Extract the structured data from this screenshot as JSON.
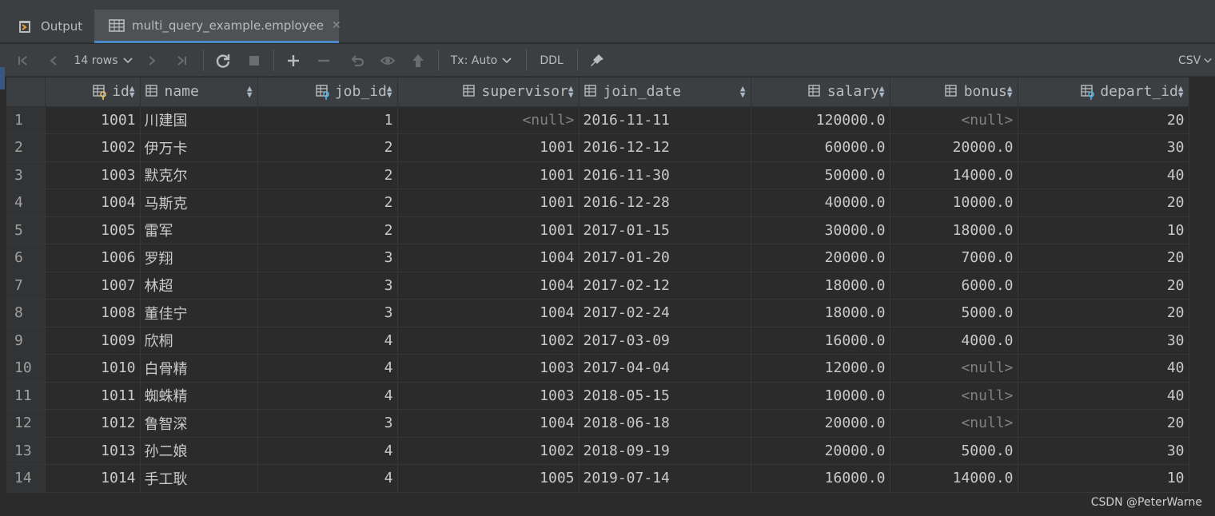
{
  "tabs": {
    "output": {
      "label": "Output"
    },
    "table": {
      "label": "multi_query_example.employee"
    }
  },
  "toolbar": {
    "rows": "14 rows",
    "tx": "Tx: Auto",
    "ddl": "DDL",
    "export": "CSV"
  },
  "columns": [
    "id",
    "name",
    "job_id",
    "supervisor",
    "join_date",
    "salary",
    "bonus",
    "depart_id"
  ],
  "rows": [
    [
      "1",
      "1001",
      "川建国",
      "1",
      "<null>",
      "2016-11-11",
      "120000.0",
      "<null>",
      "20"
    ],
    [
      "2",
      "1002",
      "伊万卡",
      "2",
      "1001",
      "2016-12-12",
      "60000.0",
      "20000.0",
      "30"
    ],
    [
      "3",
      "1003",
      "默克尔",
      "2",
      "1001",
      "2016-11-30",
      "50000.0",
      "14000.0",
      "40"
    ],
    [
      "4",
      "1004",
      "马斯克",
      "2",
      "1001",
      "2016-12-28",
      "40000.0",
      "10000.0",
      "20"
    ],
    [
      "5",
      "1005",
      "雷军",
      "2",
      "1001",
      "2017-01-15",
      "30000.0",
      "18000.0",
      "10"
    ],
    [
      "6",
      "1006",
      "罗翔",
      "3",
      "1004",
      "2017-01-20",
      "20000.0",
      "7000.0",
      "20"
    ],
    [
      "7",
      "1007",
      "林超",
      "3",
      "1004",
      "2017-02-12",
      "18000.0",
      "6000.0",
      "20"
    ],
    [
      "8",
      "1008",
      "董佳宁",
      "3",
      "1004",
      "2017-02-24",
      "18000.0",
      "5000.0",
      "20"
    ],
    [
      "9",
      "1009",
      "欣桐",
      "4",
      "1002",
      "2017-03-09",
      "16000.0",
      "4000.0",
      "30"
    ],
    [
      "10",
      "1010",
      "白骨精",
      "4",
      "1003",
      "2017-04-04",
      "12000.0",
      "<null>",
      "40"
    ],
    [
      "11",
      "1011",
      "蜘蛛精",
      "4",
      "1003",
      "2018-05-15",
      "10000.0",
      "<null>",
      "40"
    ],
    [
      "12",
      "1012",
      "鲁智深",
      "3",
      "1004",
      "2018-06-18",
      "20000.0",
      "<null>",
      "20"
    ],
    [
      "13",
      "1013",
      "孙二娘",
      "4",
      "1002",
      "2018-09-19",
      "20000.0",
      "5000.0",
      "30"
    ],
    [
      "14",
      "1014",
      "手工耿",
      "4",
      "1005",
      "2019-07-14",
      "16000.0",
      "14000.0",
      "10"
    ]
  ],
  "watermark": "CSDN @PeterWarne"
}
